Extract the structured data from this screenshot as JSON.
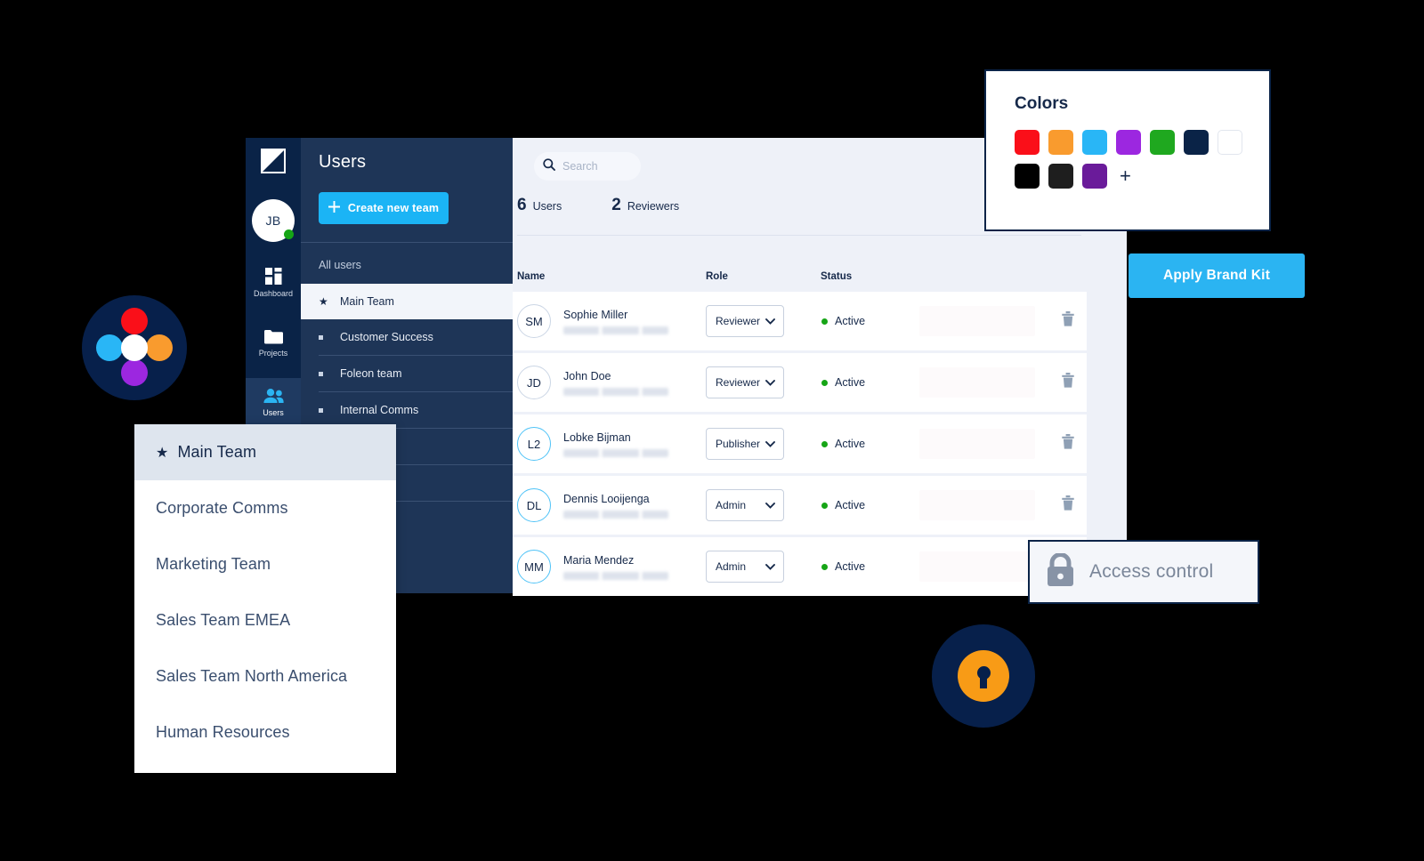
{
  "app": {
    "rail": {
      "logo_name": "foleon-logo",
      "avatar_initials": "JB",
      "items": [
        {
          "label": "Dashboard",
          "icon": "dashboard-icon",
          "active": false
        },
        {
          "label": "Projects",
          "icon": "folder-icon",
          "active": false
        },
        {
          "label": "Users",
          "icon": "users-icon",
          "active": true
        }
      ]
    },
    "teams_panel": {
      "title": "Users",
      "create_button": "Create new team",
      "create_icon": "plus-icon",
      "all_users_label": "All users",
      "teams": [
        {
          "label": "Main Team",
          "selected": true,
          "icon": "star-icon"
        },
        {
          "label": "Customer Success",
          "selected": false,
          "icon": "square-bullet-icon"
        },
        {
          "label": "Foleon team",
          "selected": false,
          "icon": "square-bullet-icon"
        },
        {
          "label": "Internal Comms",
          "selected": false,
          "icon": "square-bullet-icon"
        }
      ]
    },
    "content": {
      "search": {
        "value": "",
        "placeholder": "Search",
        "icon": "search-icon"
      },
      "stats": [
        {
          "number": "6",
          "label": "Users"
        },
        {
          "number": "2",
          "label": "Reviewers"
        }
      ],
      "table": {
        "headers": {
          "name": "Name",
          "role": "Role",
          "status": "Status"
        },
        "rows": [
          {
            "initials": "SM",
            "name": "Sophie Miller",
            "role": "Reviewer",
            "status": "Active",
            "avatar_style": "grey"
          },
          {
            "initials": "JD",
            "name": "John Doe",
            "role": "Reviewer",
            "status": "Active",
            "avatar_style": "grey"
          },
          {
            "initials": "L2",
            "name": "Lobke Bijman",
            "role": "Publisher",
            "status": "Active",
            "avatar_style": "blue"
          },
          {
            "initials": "DL",
            "name": "Dennis Looijenga",
            "role": "Admin",
            "status": "Active",
            "avatar_style": "blue"
          },
          {
            "initials": "MM",
            "name": "Maria Mendez",
            "role": "Admin",
            "status": "Active",
            "avatar_style": "blue"
          }
        ],
        "delete_icon": "trash-icon",
        "dropdown_icon": "chevron-down-icon"
      }
    }
  },
  "team_dropdown": {
    "items": [
      {
        "label": "Main Team",
        "selected": true,
        "icon": "star-icon"
      },
      {
        "label": "Corporate Comms",
        "selected": false
      },
      {
        "label": "Marketing Team",
        "selected": false
      },
      {
        "label": "Sales Team EMEA",
        "selected": false
      },
      {
        "label": "Sales Team North America",
        "selected": false
      },
      {
        "label": "Human Resources",
        "selected": false
      }
    ]
  },
  "colors_card": {
    "title": "Colors",
    "add_label": "+",
    "swatches": [
      "#FA0F19",
      "#F99B2E",
      "#29B6F6",
      "#9C27E0",
      "#1FA81F",
      "#0A2347",
      "#FFFFFF",
      "#000000",
      "#1E1E1E",
      "#6A1B9A"
    ]
  },
  "brand_button": {
    "label": "Apply Brand Kit",
    "color": "#2BB4F2"
  },
  "access_badge": {
    "label": "Access control",
    "icon": "lock-icon"
  },
  "decor": {
    "color_wheel": {
      "name": "color-wheel-circle",
      "background": "#07204B",
      "dots": [
        "#FA0F19",
        "#F99B2E",
        "#9C27E0",
        "#29B6F6",
        "#FFFFFF"
      ]
    },
    "lock_circle": {
      "name": "lock-circle",
      "background": "#07204B",
      "accent": "#F89B16"
    }
  }
}
